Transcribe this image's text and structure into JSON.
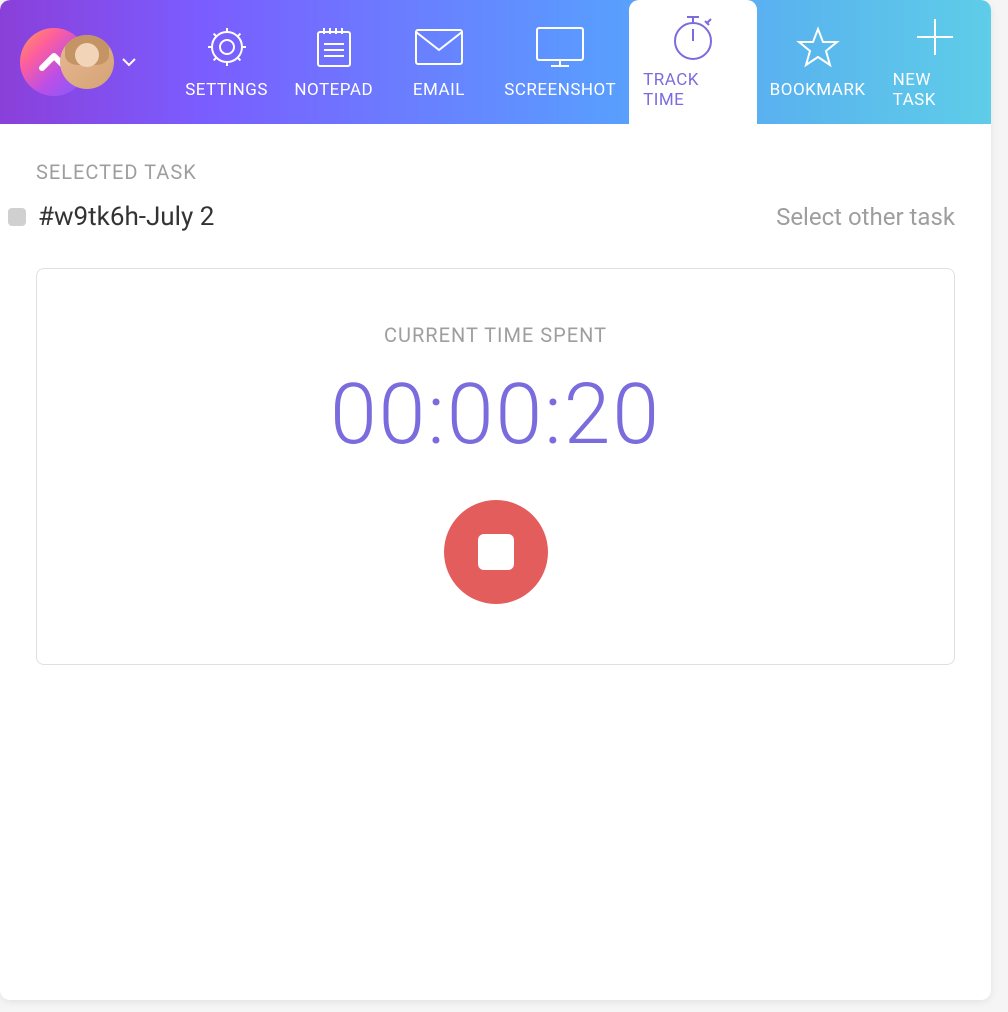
{
  "header": {
    "tabs": [
      {
        "label": "SETTINGS",
        "icon": "gear"
      },
      {
        "label": "NOTEPAD",
        "icon": "notepad"
      },
      {
        "label": "EMAIL",
        "icon": "email"
      },
      {
        "label": "SCREENSHOT",
        "icon": "screenshot"
      },
      {
        "label": "TRACK TIME",
        "icon": "stopwatch",
        "active": true
      },
      {
        "label": "BOOKMARK",
        "icon": "star"
      },
      {
        "label": "NEW TASK",
        "icon": "plus"
      }
    ]
  },
  "task": {
    "section_label": "SELECTED TASK",
    "title": "#w9tk6h-July 2",
    "select_other_label": "Select other task"
  },
  "timer": {
    "label": "CURRENT TIME SPENT",
    "value": "00:00:20"
  },
  "colors": {
    "accent": "#7B6CDE",
    "stop_button": "#E35D5D"
  }
}
